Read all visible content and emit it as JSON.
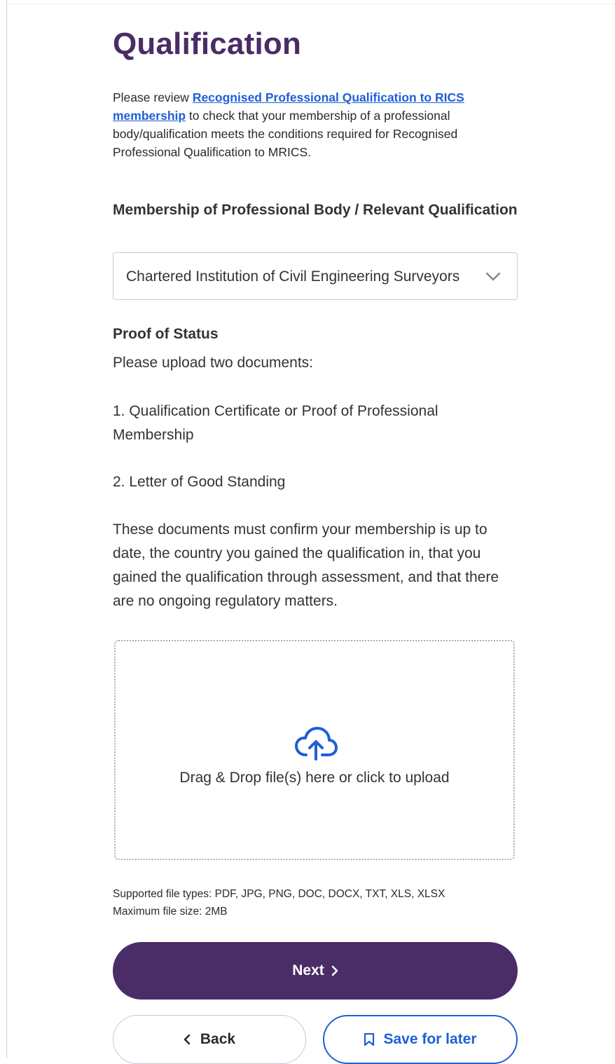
{
  "page": {
    "title": "Qualification",
    "intro": {
      "prefix": "Please review ",
      "link_text": "Recognised Professional Qualification to RICS membership",
      "suffix": " to check that your membership of a professional body/qualification meets the conditions required for Recognised Professional Qualification to MRICS."
    }
  },
  "membership_select": {
    "label": "Membership of Professional Body / Relevant Qualification",
    "selected_value": "Chartered Institution of Civil Engineering Surveyors",
    "icon": "chevron-down-icon"
  },
  "proof_of_status": {
    "heading": "Proof of Status",
    "instructions": [
      "Please upload two documents:",
      "1. Qualification Certificate or Proof of Professional Membership",
      "2. Letter of Good Standing",
      "These documents must confirm your membership is up to date, the country you gained the qualification in, that you gained the qualification through assessment, and that there are no ongoing regulatory matters."
    ]
  },
  "upload": {
    "icon": "cloud-upload-icon",
    "prompt": "Drag & Drop file(s) here or click to upload",
    "supported_types": "Supported file types: PDF, JPG, PNG, DOC, DOCX, TXT, XLS, XLSX",
    "max_size": "Maximum file size: 2MB"
  },
  "actions": {
    "next_label": "Next",
    "back_label": "Back",
    "save_label": "Save for later"
  },
  "colors": {
    "brand_purple": "#4a2c66",
    "link_blue": "#1f5fd6",
    "text": "#333333",
    "border": "#c8ccd3"
  }
}
